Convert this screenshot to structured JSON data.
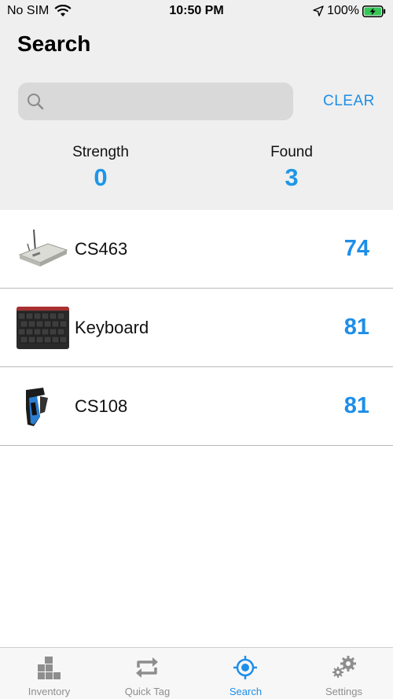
{
  "status_bar": {
    "carrier": "No SIM",
    "time": "10:50 PM",
    "battery": "100%"
  },
  "header": {
    "title": "Search"
  },
  "search": {
    "placeholder": "",
    "value": "",
    "clear_label": "CLEAR"
  },
  "stats": {
    "strength": {
      "label": "Strength",
      "value": "0"
    },
    "found": {
      "label": "Found",
      "value": "3"
    }
  },
  "results": [
    {
      "name": "CS463",
      "rssi": "74",
      "image": "cs463-reader-image"
    },
    {
      "name": "Keyboard",
      "rssi": "81",
      "image": "keyboard-image"
    },
    {
      "name": "CS108",
      "rssi": "81",
      "image": "cs108-handheld-image"
    }
  ],
  "tabs": [
    {
      "label": "Inventory",
      "icon": "boxes-icon",
      "active": false
    },
    {
      "label": "Quick Tag",
      "icon": "repeat-icon",
      "active": false
    },
    {
      "label": "Search",
      "icon": "target-icon",
      "active": true
    },
    {
      "label": "Settings",
      "icon": "gears-icon",
      "active": false
    }
  ],
  "colors": {
    "accent": "#1e8ee8",
    "header_bg": "#efefef",
    "search_bg": "#d9d9d9",
    "battery": "#35c759"
  }
}
